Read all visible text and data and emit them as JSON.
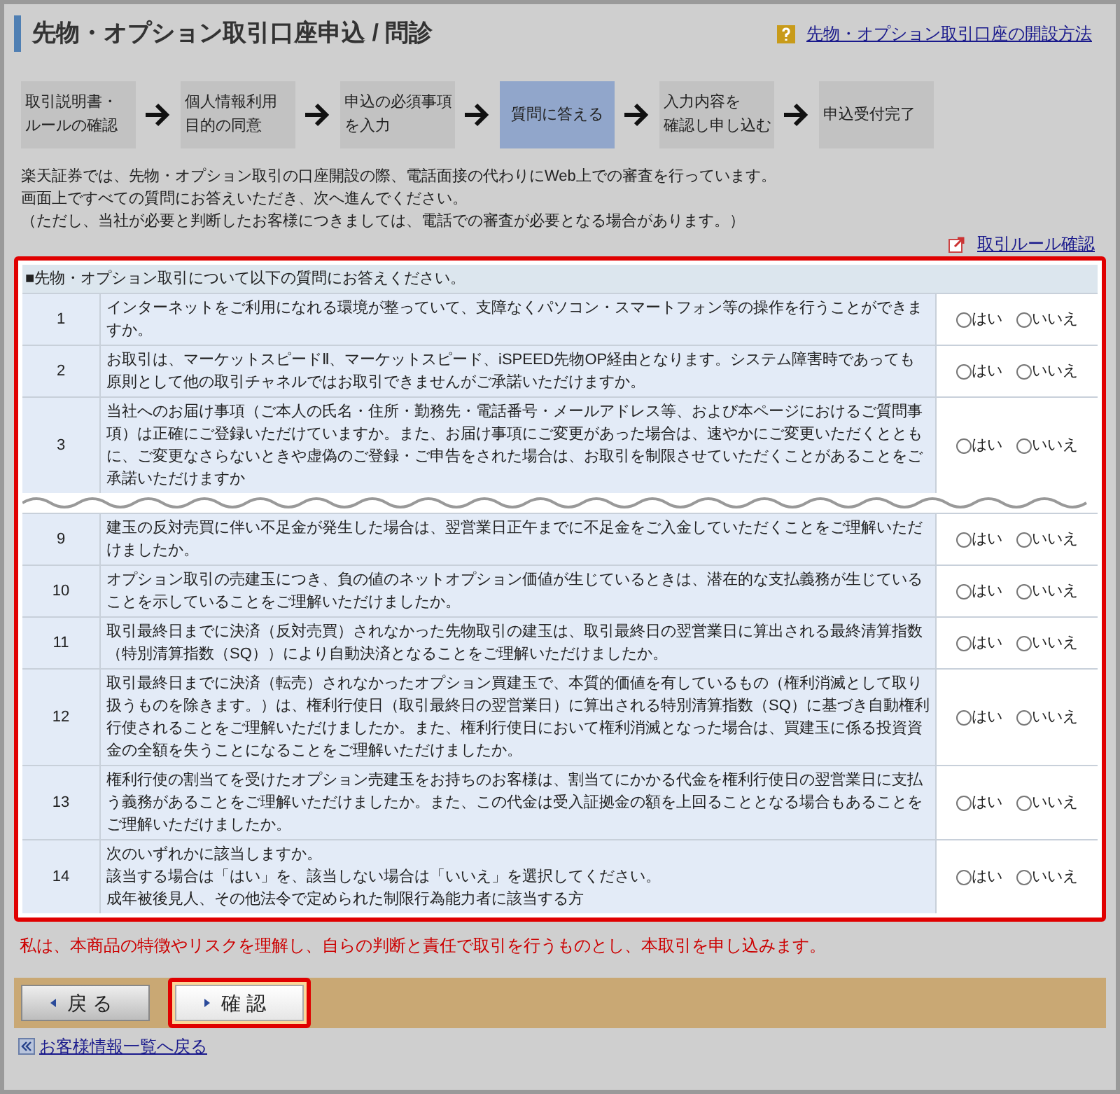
{
  "header": {
    "title": "先物・オプション取引口座申込 / 問診",
    "help_link": "先物・オプション取引口座の開設方法"
  },
  "steps": [
    {
      "lines": [
        "取引説明書・",
        "ルールの確認"
      ],
      "selected": false
    },
    {
      "lines": [
        "個人情報利用",
        "目的の同意"
      ],
      "selected": false
    },
    {
      "lines": [
        "申込の必須事項",
        "を入力"
      ],
      "selected": false
    },
    {
      "lines": [
        "質問に答える"
      ],
      "selected": true
    },
    {
      "lines": [
        "入力内容を",
        "確認し申し込む"
      ],
      "selected": false
    },
    {
      "lines": [
        "申込受付完了"
      ],
      "selected": false
    }
  ],
  "intro": [
    "楽天証券では、先物・オプション取引の口座開設の際、電話面接の代わりにWeb上での審査を行っています。",
    "画面上ですべての質問にお答えいただき、次へ進んでください。",
    "（ただし、当社が必要と判断したお客様につきましては、電話での審査が必要となる場合があります。）"
  ],
  "rules_link": "取引ルール確認",
  "questions": {
    "heading": "■先物・オプション取引について以下の質問にお答えください。",
    "rows": [
      {
        "no": "1",
        "text": "インターネットをご利用になれる環境が整っていて、支障なくパソコン・スマートフォン等の操作を行うことができますか。",
        "answers": [
          {
            "label": "はい",
            "selected": false
          },
          {
            "label": "いいえ",
            "selected": false
          }
        ]
      },
      {
        "no": "2",
        "text": "お取引は、マーケットスピードⅡ、マーケットスピード、iSPEED先物OP経由となります。システム障害時であっても原則として他の取引チャネルではお取引できませんがご承諾いただけますか。",
        "answers": [
          {
            "label": "はい",
            "selected": false
          },
          {
            "label": "いいえ",
            "selected": false
          }
        ]
      },
      {
        "no": "3",
        "text": "当社へのお届け事項（ご本人の氏名・住所・勤務先・電話番号・メールアドレス等、および本ページにおけるご質問事項）は正確にご登録いただけていますか。また、お届け事項にご変更があった場合は、速やかにご変更いただくとともに、ご変更なさらないときや虚偽のご登録・ご申告をされた場合は、お取引を制限させていただくことがあることをご承諾いただけますか",
        "answers": [
          {
            "label": "はい",
            "selected": false
          },
          {
            "label": "いいえ",
            "selected": false
          }
        ]
      },
      {
        "no": "9",
        "text": "建玉の反対売買に伴い不足金が発生した場合は、翌営業日正午までに不足金をご入金していただくことをご理解いただけましたか。",
        "break_before": true,
        "answers": [
          {
            "label": "はい",
            "selected": false
          },
          {
            "label": "いいえ",
            "selected": false
          }
        ]
      },
      {
        "no": "10",
        "text": "オプション取引の売建玉につき、負の値のネットオプション価値が生じているときは、潜在的な支払義務が生じていることを示していることをご理解いただけましたか。",
        "answers": [
          {
            "label": "はい",
            "selected": false
          },
          {
            "label": "いいえ",
            "selected": false
          }
        ]
      },
      {
        "no": "11",
        "text": "取引最終日までに決済（反対売買）されなかった先物取引の建玉は、取引最終日の翌営業日に算出される最終清算指数（特別清算指数（SQ））により自動決済となることをご理解いただけましたか。",
        "answers": [
          {
            "label": "はい",
            "selected": false
          },
          {
            "label": "いいえ",
            "selected": false
          }
        ]
      },
      {
        "no": "12",
        "text": "取引最終日までに決済（転売）されなかったオプション買建玉で、本質的価値を有しているもの（権利消滅として取り扱うものを除きます。）は、権利行使日（取引最終日の翌営業日）に算出される特別清算指数（SQ）に基づき自動権利行使されることをご理解いただけましたか。また、権利行使日において権利消滅となった場合は、買建玉に係る投資資金の全額を失うことになることをご理解いただけましたか。",
        "answers": [
          {
            "label": "はい",
            "selected": false
          },
          {
            "label": "いいえ",
            "selected": false
          }
        ]
      },
      {
        "no": "13",
        "text": "権利行使の割当てを受けたオプション売建玉をお持ちのお客様は、割当てにかかる代金を権利行使日の翌営業日に支払う義務があることをご理解いただけましたか。また、この代金は受入証拠金の額を上回ることとなる場合もあることをご理解いただけましたか。",
        "answers": [
          {
            "label": "はい",
            "selected": false
          },
          {
            "label": "いいえ",
            "selected": false
          }
        ]
      },
      {
        "no": "14",
        "lines": [
          "次のいずれかに該当しますか。",
          "該当する場合は「はい」を、該当しない場合は「いいえ」を選択してください。",
          "成年被後見人、その他法令で定められた制限行為能力者に該当する方"
        ],
        "answers": [
          {
            "label": "はい",
            "selected": false
          },
          {
            "label": "いいえ",
            "selected": false
          }
        ]
      }
    ]
  },
  "agreement": "私は、本商品の特徴やリスクを理解し、自らの判断と責任で取引を行うものとし、本取引を申し込みます。",
  "buttons": [
    {
      "label": "戻 る",
      "highlighted": false
    },
    {
      "label": "確 認",
      "highlighted": true
    }
  ],
  "back_link": "お客様情報一覧へ戻る"
}
